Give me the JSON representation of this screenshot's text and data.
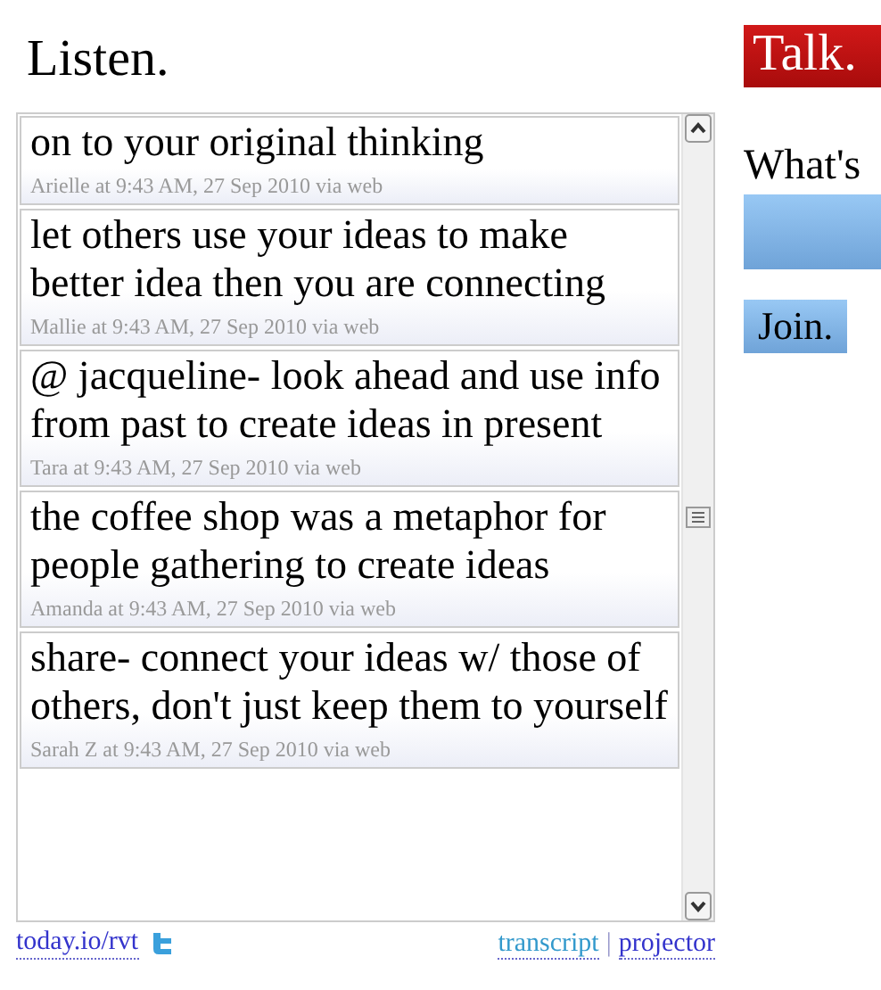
{
  "listen": {
    "title": "Listen.",
    "posts": [
      {
        "text": "on to your original thinking",
        "meta": "Arielle at 9:43 AM, 27 Sep 2010 via web"
      },
      {
        "text": "let others use your ideas to make better idea then you are connecting",
        "meta": "Mallie at 9:43 AM, 27 Sep 2010 via web"
      },
      {
        "text": "@ jacqueline- look ahead and use info from past to create ideas in present",
        "meta": "Tara at 9:43 AM, 27 Sep 2010 via web"
      },
      {
        "text": "the coffee shop was a metaphor for people gathering to create ideas",
        "meta": "Amanda at 9:43 AM, 27 Sep 2010 via web"
      },
      {
        "text": "share- connect your ideas w/ those of others, don't just keep them to yourself",
        "meta": "Sarah Z at 9:43 AM, 27 Sep 2010 via web"
      }
    ],
    "footer": {
      "short_link": "today.io/rvt",
      "links": [
        "transcript",
        "projector"
      ],
      "separator": "|"
    }
  },
  "talk": {
    "title": "Talk.",
    "prompt": "What's",
    "join": "Join."
  }
}
